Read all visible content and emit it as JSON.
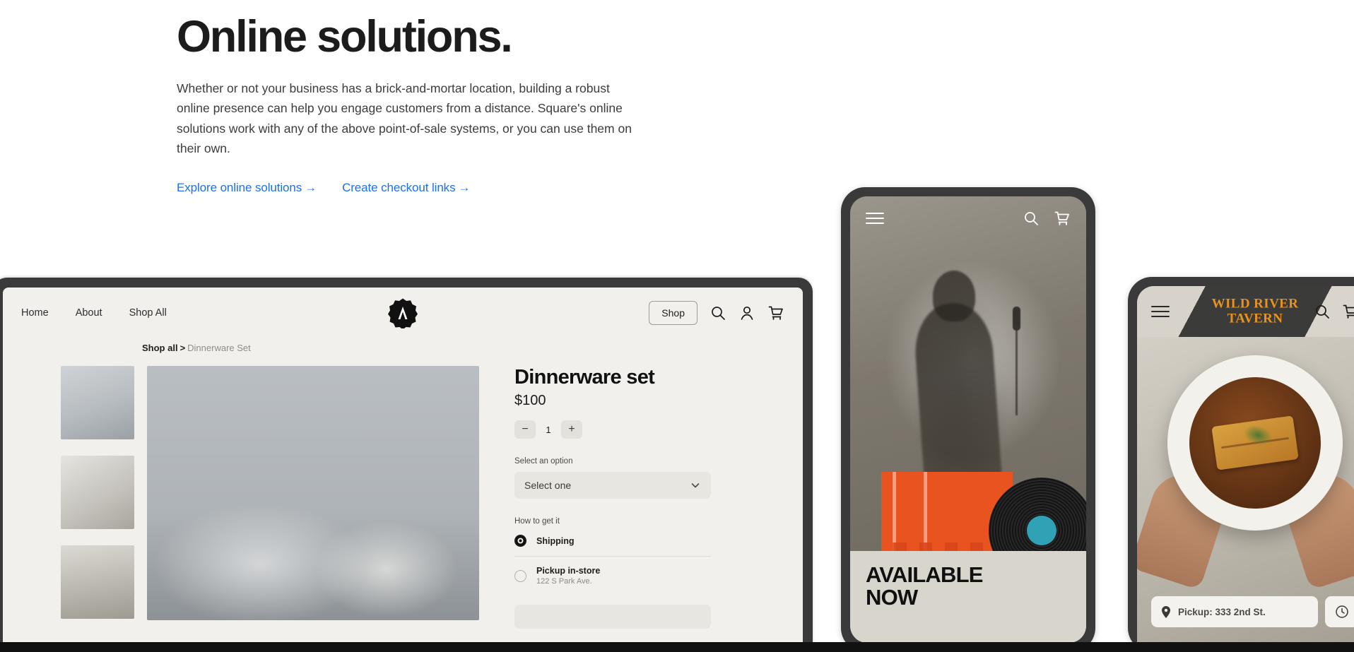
{
  "hero": {
    "title": "Online solutions.",
    "body": "Whether or not your business has a brick-and-mortar location, building a robust online presence can help you engage customers from a distance. Square's online solutions work with any of the above point-of-sale systems, or you can use them on their own.",
    "links": [
      {
        "label": "Explore online solutions",
        "arrow": "→"
      },
      {
        "label": "Create checkout links",
        "arrow": "→"
      }
    ],
    "link_color": "#1f6feb"
  },
  "tablet": {
    "nav": {
      "items": [
        "Home",
        "About",
        "Shop All"
      ],
      "shop_button": "Shop",
      "icons": [
        "search-icon",
        "account-icon",
        "cart-icon"
      ]
    },
    "breadcrumb": {
      "root": "Shop all",
      "separator": ">",
      "current": "Dinnerware Set"
    },
    "product": {
      "title": "Dinnerware set",
      "price": "$100",
      "quantity": "1",
      "decrement": "−",
      "increment": "+",
      "option_label": "Select an option",
      "option_value": "Select one",
      "fulfillment_label": "How to get it",
      "fulfillment": [
        {
          "name": "Shipping",
          "detail": "",
          "selected": true
        },
        {
          "name": "Pickup in-store",
          "detail": "122 S Park Ave.",
          "selected": false
        }
      ]
    }
  },
  "phone_music": {
    "icons": [
      "menu-icon",
      "search-icon",
      "cart-icon"
    ],
    "headline_line1": "AVAILABLE",
    "headline_line2": "NOW"
  },
  "phone_tavern": {
    "icons": [
      "menu-icon",
      "search-icon",
      "cart-icon"
    ],
    "brand_line1": "WILD RIVER",
    "brand_line2": "TAVERN",
    "brand_color": "#e8921f",
    "pickup_label": "Pickup: 333 2nd St."
  }
}
